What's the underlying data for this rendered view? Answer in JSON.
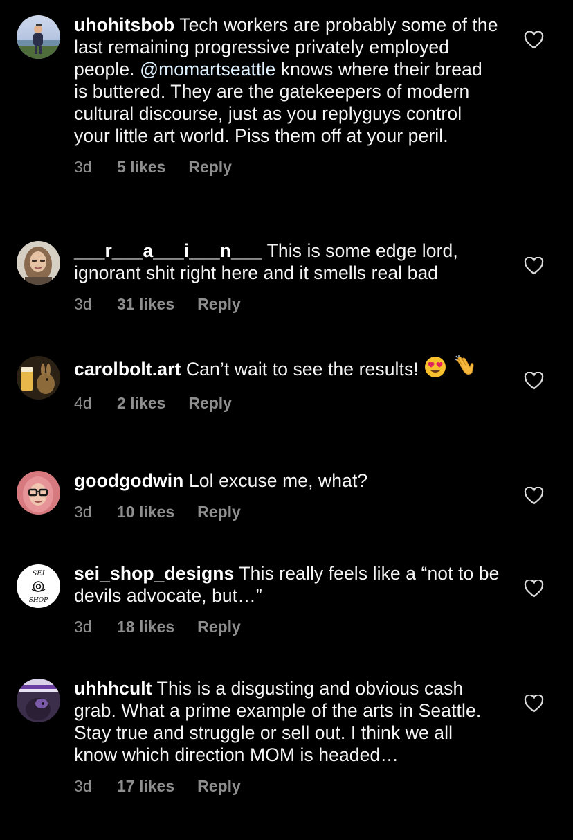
{
  "comments": [
    {
      "username": "uhohitsbob",
      "text_before": "Tech workers are probably some of the last remaining progressive privately employed people.",
      "mention": "@momartseattle",
      "text_after": "knows where their bread is buttered. They are the gatekeepers of modern cultural discourse, just as you replyguys control your little art world. Piss them off at your peril.",
      "age": "3d",
      "likes": "5 likes",
      "reply": "Reply"
    },
    {
      "username": "___r___a___i___n___",
      "text": "This is some edge lord, ignorant shit right here and it smells real bad",
      "age": "3d",
      "likes": "31 likes",
      "reply": "Reply"
    },
    {
      "username": "carolbolt.art",
      "text": "Can’t wait to see the results!",
      "emojis": [
        "heart-eyes-emoji",
        "clapping-hands-emoji"
      ],
      "age": "4d",
      "likes": "2 likes",
      "reply": "Reply"
    },
    {
      "username": "goodgodwin",
      "text": "Lol excuse me, what?",
      "age": "3d",
      "likes": "10 likes",
      "reply": "Reply"
    },
    {
      "username": "sei_shop_designs",
      "text": "This really feels like a “not to be devils advocate, but…”",
      "avatar_text_top": "SEI",
      "avatar_text_bottom": "SHOP",
      "age": "3d",
      "likes": "18 likes",
      "reply": "Reply"
    },
    {
      "username": "uhhhcult",
      "text": "This is a disgusting and obvious cash grab. What a prime example of the arts in Seattle. Stay true and struggle or sell out. I think we all know which direction MOM is headed…",
      "age": "3d",
      "likes": "17 likes",
      "reply": "Reply"
    }
  ],
  "icons": {
    "like": "heart-outline-icon"
  },
  "colors": {
    "background": "#000000",
    "text": "#f5f5f5",
    "meta": "#8e8e8e",
    "mention": "#e0f1ff"
  }
}
